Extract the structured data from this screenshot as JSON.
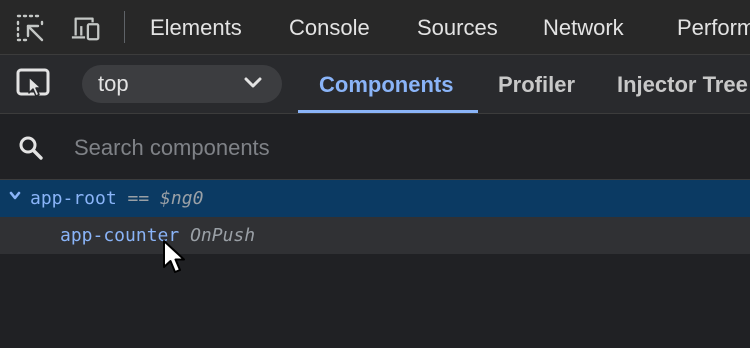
{
  "devtools_tabs": [
    "Elements",
    "Console",
    "Sources",
    "Network",
    "Perform"
  ],
  "toolbar": {
    "frame_select_value": "top",
    "tabs": [
      "Components",
      "Profiler",
      "Injector Tree"
    ],
    "active_tab": "Components"
  },
  "search": {
    "placeholder": "Search components",
    "value": ""
  },
  "tree": {
    "rows": [
      {
        "name": "app-root",
        "meta": "== $ng0",
        "selected": true,
        "expanded": true
      },
      {
        "name": "app-counter",
        "meta": "OnPush",
        "selected": false
      }
    ]
  },
  "colors": {
    "accent": "#8ab4f8",
    "selected_row": "#0b3a63",
    "background": "#202124"
  },
  "icons": [
    "inspect-element-icon",
    "device-toolbar-icon",
    "component-picker-icon",
    "chevron-down-icon",
    "search-icon",
    "caret-down-icon",
    "mouse-cursor-icon"
  ]
}
